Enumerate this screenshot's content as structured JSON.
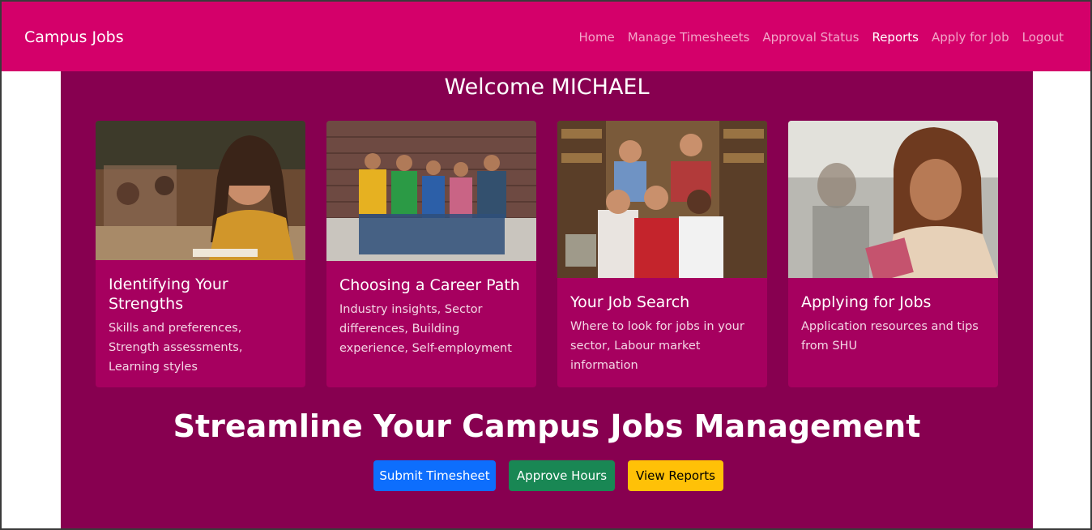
{
  "nav": {
    "brand": "Campus Jobs",
    "links": [
      {
        "label": "Home"
      },
      {
        "label": "Manage Timesheets"
      },
      {
        "label": "Approval Status"
      },
      {
        "label": "Reports"
      },
      {
        "label": "Apply for Job"
      },
      {
        "label": "Logout"
      }
    ]
  },
  "welcome": "Welcome MICHAEL",
  "cards": [
    {
      "title": "Identifying Your Strengths",
      "text": "Skills and preferences, Strength assessments, Learning styles"
    },
    {
      "title": "Choosing a Career Path",
      "text": "Industry insights, Sector differences, Building experience, Self-employment"
    },
    {
      "title": "Your Job Search",
      "text": "Where to look for jobs in your sector, Labour market information"
    },
    {
      "title": "Applying for Jobs",
      "text": "Application resources and tips from SHU"
    }
  ],
  "headline": "Streamline Your Campus Jobs Management",
  "buttons": {
    "submit": "Submit Timesheet",
    "approve": "Approve Hours",
    "reports": "View Reports"
  },
  "colors": {
    "navbar": "#d4006a",
    "content_bg": "#870050",
    "card_bg": "#a6005f",
    "primary": "#0d6efd",
    "success": "#198754",
    "warning": "#ffc107"
  }
}
